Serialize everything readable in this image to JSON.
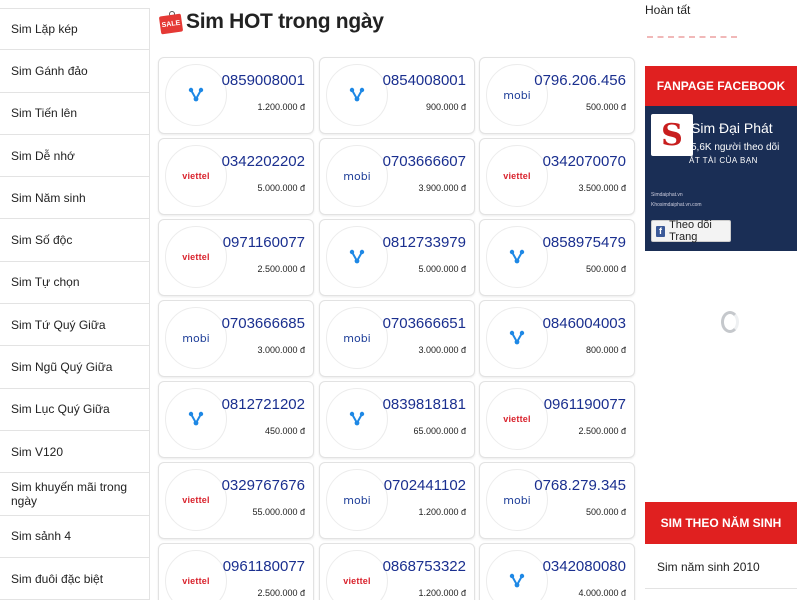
{
  "sidebar": {
    "items": [
      {
        "label": "Sim Lặp kép"
      },
      {
        "label": "Sim Gánh đảo"
      },
      {
        "label": "Sim Tiến lên"
      },
      {
        "label": "Sim Dễ nhớ"
      },
      {
        "label": "Sim Năm sinh"
      },
      {
        "label": "Sim Số độc"
      },
      {
        "label": "Sim Tự chọn"
      },
      {
        "label": "Sim Tứ Quý Giữa"
      },
      {
        "label": "Sim Ngũ Quý Giữa"
      },
      {
        "label": "Sim Lục Quý Giữa"
      },
      {
        "label": "Sim V120"
      },
      {
        "label": "Sim khuyến mãi trong ngày"
      },
      {
        "label": "Sim sảnh 4"
      },
      {
        "label": "Sim đuôi đặc biệt"
      }
    ]
  },
  "main": {
    "sale_icon_text": "SALE",
    "title": "Sim HOT trong ngày",
    "cards": [
      {
        "carrier": "vinaphone",
        "number": "0859008001",
        "price": "1.200.000 đ"
      },
      {
        "carrier": "vinaphone",
        "number": "0854008001",
        "price": "900.000 đ"
      },
      {
        "carrier": "mobifone",
        "number": "0796.206.456",
        "price": "500.000 đ"
      },
      {
        "carrier": "viettel",
        "number": "0342202202",
        "price": "5.000.000 đ"
      },
      {
        "carrier": "mobifone",
        "number": "0703666607",
        "price": "3.900.000 đ"
      },
      {
        "carrier": "viettel",
        "number": "0342070070",
        "price": "3.500.000 đ"
      },
      {
        "carrier": "viettel",
        "number": "0971160077",
        "price": "2.500.000 đ"
      },
      {
        "carrier": "vinaphone",
        "number": "0812733979",
        "price": "5.000.000 đ"
      },
      {
        "carrier": "vinaphone",
        "number": "0858975479",
        "price": "500.000 đ"
      },
      {
        "carrier": "mobifone",
        "number": "0703666685",
        "price": "3.000.000 đ"
      },
      {
        "carrier": "mobifone",
        "number": "0703666651",
        "price": "3.000.000 đ"
      },
      {
        "carrier": "vinaphone",
        "number": "0846004003",
        "price": "800.000 đ"
      },
      {
        "carrier": "vinaphone",
        "number": "0812721202",
        "price": "450.000 đ"
      },
      {
        "carrier": "vinaphone",
        "number": "0839818181",
        "price": "65.000.000 đ"
      },
      {
        "carrier": "viettel",
        "number": "0961190077",
        "price": "2.500.000 đ"
      },
      {
        "carrier": "viettel",
        "number": "0329767676",
        "price": "55.000.000 đ"
      },
      {
        "carrier": "mobifone",
        "number": "0702441102",
        "price": "1.200.000 đ"
      },
      {
        "carrier": "mobifone",
        "number": "0768.279.345",
        "price": "500.000 đ"
      },
      {
        "carrier": "viettel",
        "number": "0961180077",
        "price": "2.500.000 đ"
      },
      {
        "carrier": "viettel",
        "number": "0868753322",
        "price": "1.200.000 đ"
      },
      {
        "carrier": "vinaphone",
        "number": "0342080080",
        "price": "4.000.000 đ"
      }
    ],
    "carrier_logo_text": {
      "viettel": "viettel",
      "mobifone": "mobi"
    }
  },
  "right": {
    "done_text": "Hoàn tất",
    "fanpage_header": "FANPAGE FACEBOOK",
    "fb": {
      "logo_letter": "S",
      "page_name": "Sim Đại Phát",
      "followers": "5,6K người theo dõi",
      "slogan": "ĂT TÀI CỦA BẠN",
      "small_line_1": "Simdaiphat.vn",
      "small_line_2": "Khosimdaiphat.vn.com",
      "follow_button": "Theo dõi Trang",
      "fb_icon_letter": "f"
    },
    "sim_year_header": "SIM THEO NĂM SINH",
    "sim_year_items": [
      {
        "label": "Sim năm sinh 2010"
      }
    ]
  },
  "colors": {
    "accent_red": "#e02020",
    "number_blue": "#1a2f8f",
    "viettel_red": "#d9232d",
    "mobi_blue": "#1f3f99",
    "vina_blue": "#1e88e5"
  }
}
